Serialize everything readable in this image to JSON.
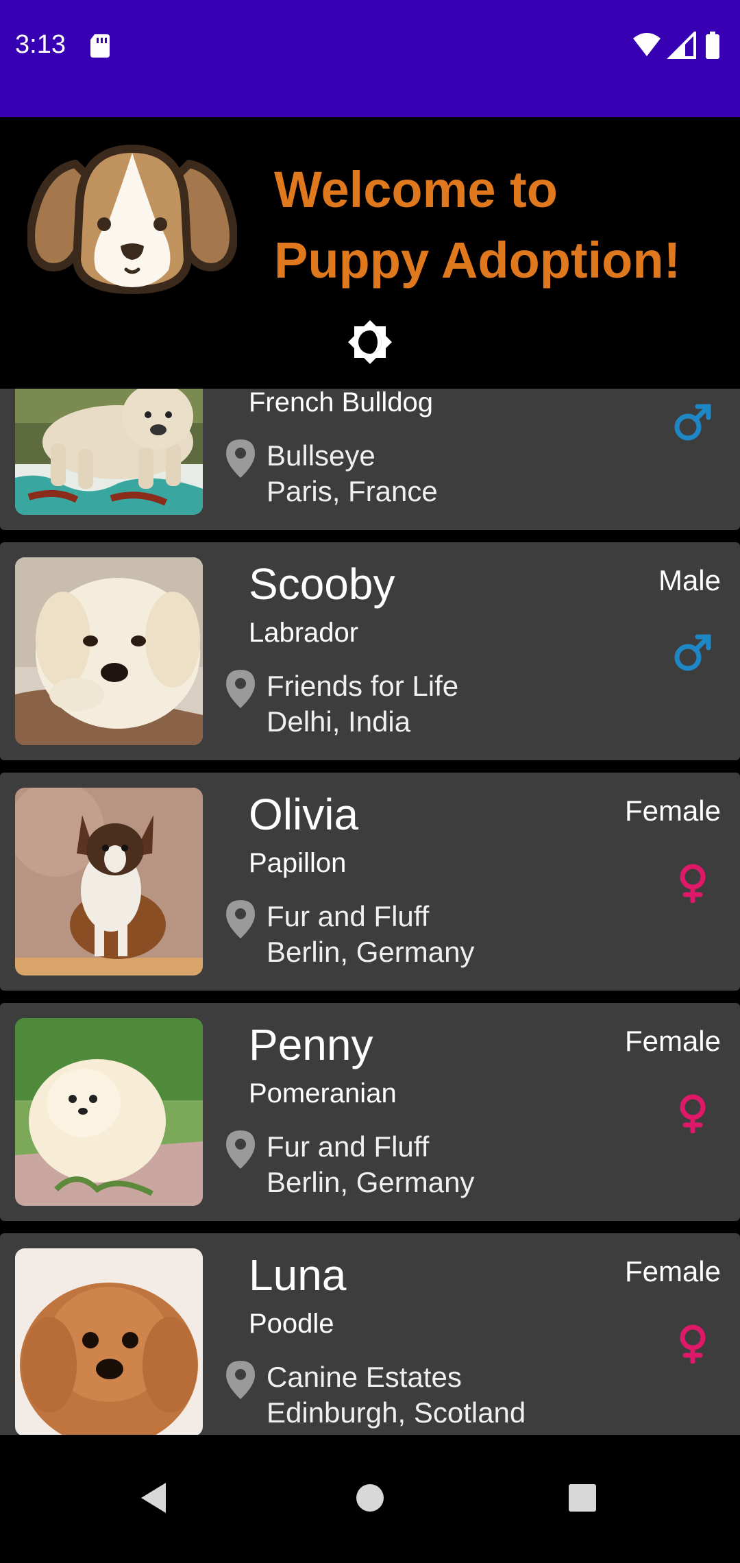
{
  "status_bar": {
    "time": "3:13",
    "icons": [
      "sd-card-icon",
      "wifi-icon",
      "signal-icon",
      "battery-icon"
    ],
    "background": "#3700b3"
  },
  "header": {
    "welcome_line1": "Welcome to",
    "welcome_line2": "Puppy Adoption!",
    "title_color": "#e0781e",
    "logo": "puppy-face-logo",
    "theme_toggle_icon": "brightness-icon"
  },
  "colors": {
    "card_bg": "#3d3d3d",
    "male": "#1e88c7",
    "female": "#e0186a"
  },
  "puppies": [
    {
      "name": "",
      "breed": "French Bulldog",
      "shelter": "Bullseye",
      "location": "Paris, France",
      "gender": "",
      "gender_icon": "male-icon",
      "photo": "french-bulldog-photo"
    },
    {
      "name": "Scooby",
      "breed": "Labrador",
      "shelter": "Friends for Life",
      "location": "Delhi, India",
      "gender": "Male",
      "gender_icon": "male-icon",
      "photo": "labrador-photo"
    },
    {
      "name": "Olivia",
      "breed": "Papillon",
      "shelter": "Fur and Fluff",
      "location": "Berlin, Germany",
      "gender": "Female",
      "gender_icon": "female-icon",
      "photo": "papillon-photo"
    },
    {
      "name": "Penny",
      "breed": "Pomeranian",
      "shelter": "Fur and Fluff",
      "location": "Berlin, Germany",
      "gender": "Female",
      "gender_icon": "female-icon",
      "photo": "pomeranian-photo"
    },
    {
      "name": "Luna",
      "breed": "Poodle",
      "shelter": "Canine Estates",
      "location": "Edinburgh, Scotland",
      "gender": "Female",
      "gender_icon": "female-icon",
      "photo": "poodle-photo"
    }
  ],
  "nav_bar": {
    "buttons": [
      "back-icon",
      "home-icon",
      "recents-icon"
    ]
  }
}
